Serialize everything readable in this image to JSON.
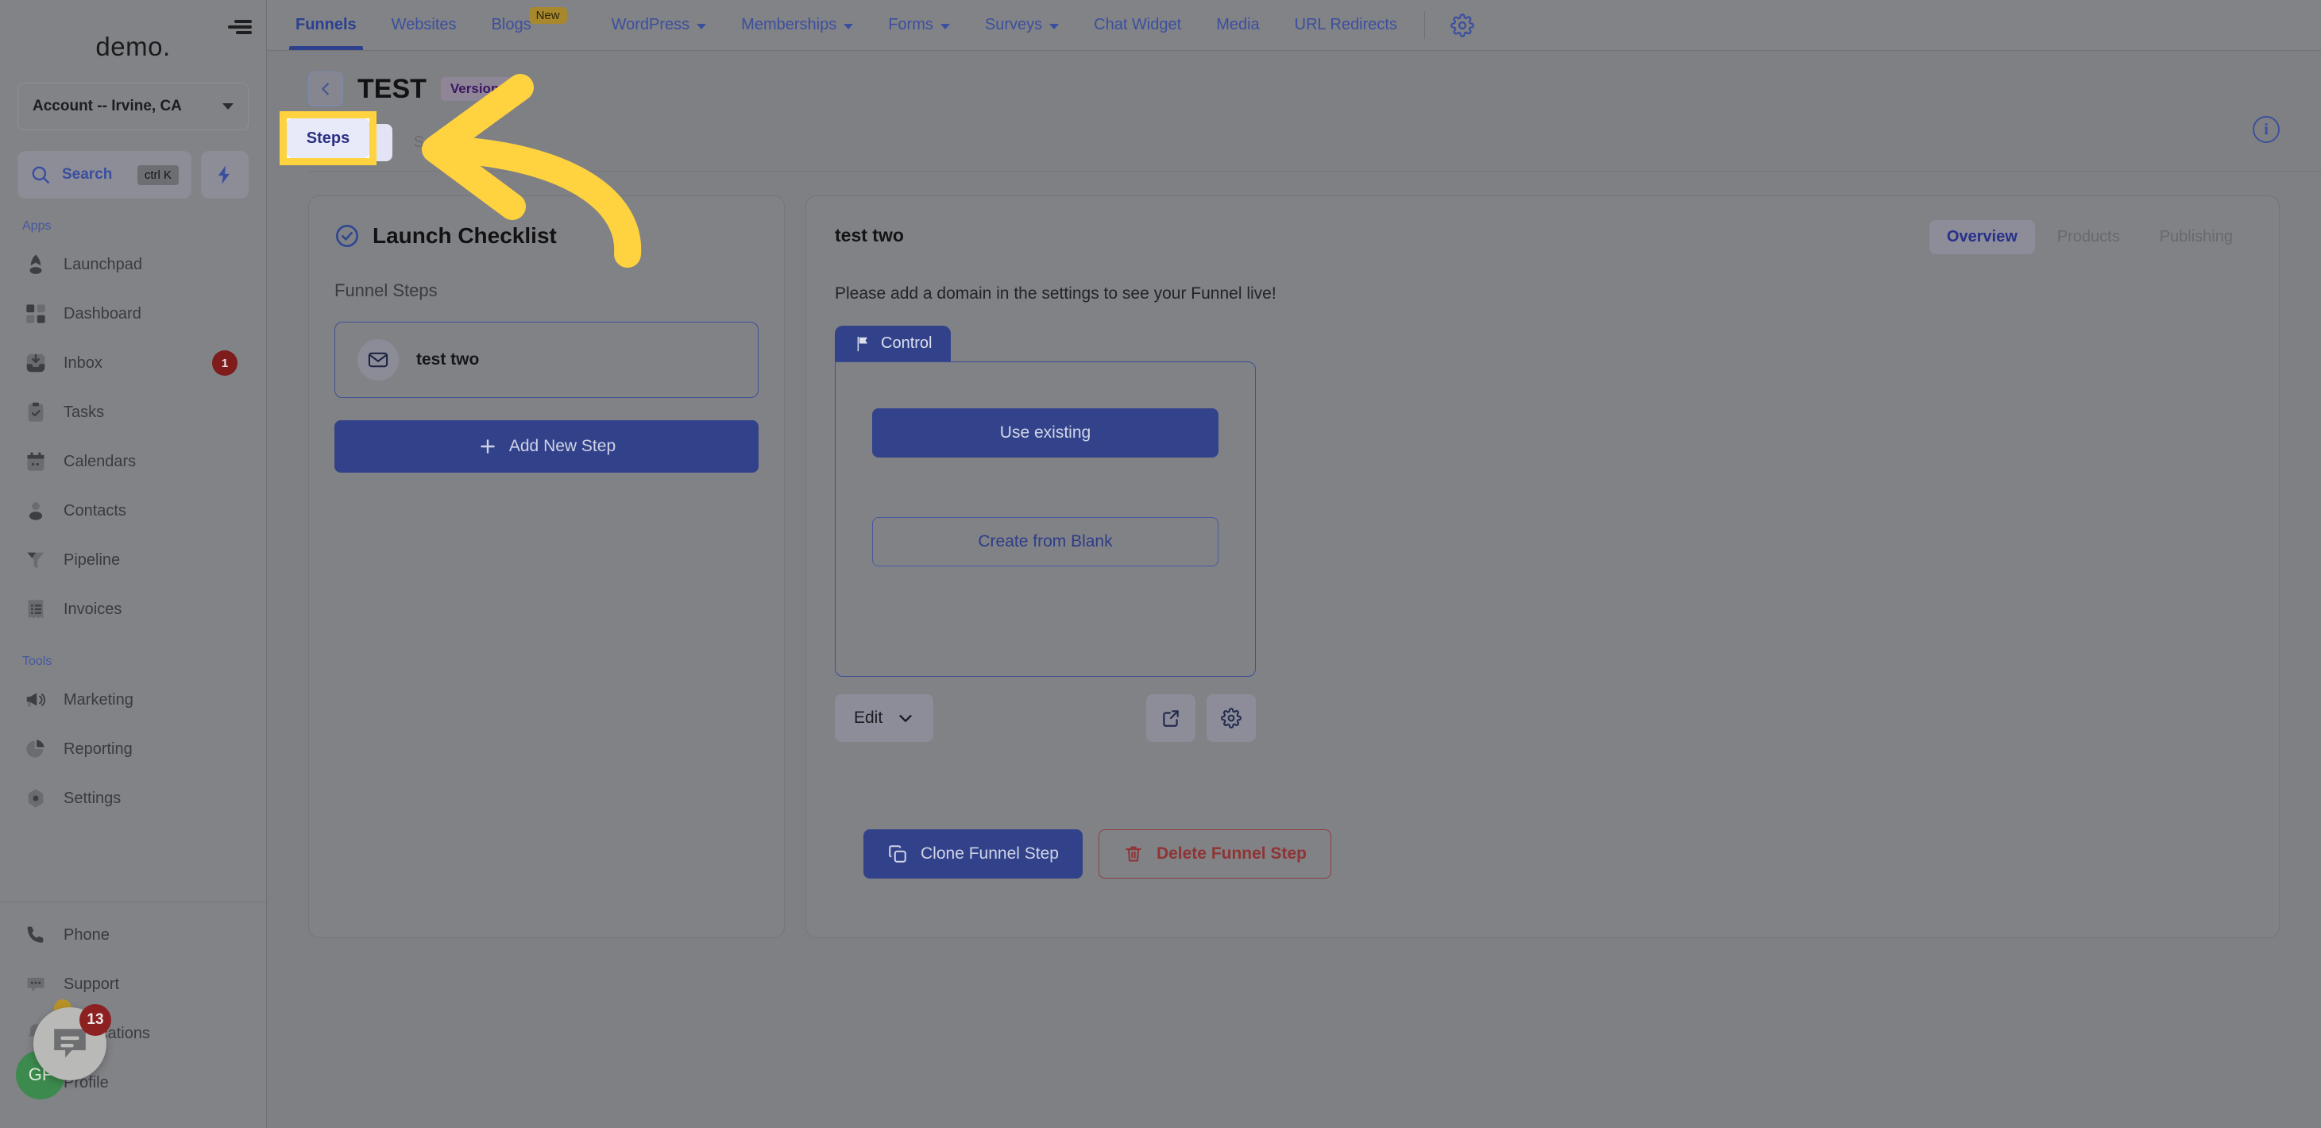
{
  "sidebar": {
    "brand": "demo.",
    "account_selector": "Account -- Irvine, CA",
    "search": {
      "label": "Search",
      "shortcut": "ctrl K"
    },
    "section_apps": "Apps",
    "section_tools": "Tools",
    "apps": [
      {
        "label": "Launchpad",
        "icon": "rocket-icon",
        "badge": ""
      },
      {
        "label": "Dashboard",
        "icon": "grid-icon",
        "badge": ""
      },
      {
        "label": "Inbox",
        "icon": "inbox-icon",
        "badge": "1"
      },
      {
        "label": "Tasks",
        "icon": "clipboard-check-icon",
        "badge": ""
      },
      {
        "label": "Calendars",
        "icon": "calendar-icon",
        "badge": ""
      },
      {
        "label": "Contacts",
        "icon": "person-icon",
        "badge": ""
      },
      {
        "label": "Pipeline",
        "icon": "funnel-icon",
        "badge": ""
      },
      {
        "label": "Invoices",
        "icon": "invoice-icon",
        "badge": ""
      }
    ],
    "tools": [
      {
        "label": "Marketing",
        "icon": "megaphone-icon",
        "badge": ""
      },
      {
        "label": "Reporting",
        "icon": "pie-chart-icon",
        "badge": ""
      },
      {
        "label": "Settings",
        "icon": "gear-hex-icon",
        "badge": ""
      }
    ],
    "bottom": [
      {
        "label": "Phone",
        "icon": "phone-icon",
        "badge": ""
      },
      {
        "label": "Support",
        "icon": "chat-dots-icon",
        "badge": ""
      },
      {
        "label": "Notifications",
        "icon": "bell-icon",
        "badge": ""
      },
      {
        "label": "Profile",
        "icon": "avatar-icon",
        "badge": ""
      }
    ],
    "chat_widget": {
      "badge": "13",
      "avatar_initials": "GF"
    }
  },
  "topnav": {
    "items": [
      {
        "label": "Funnels",
        "active": true,
        "caret": false,
        "pill": ""
      },
      {
        "label": "Websites",
        "active": false,
        "caret": false,
        "pill": ""
      },
      {
        "label": "Blogs",
        "active": false,
        "caret": false,
        "pill": "New"
      },
      {
        "label": "WordPress",
        "active": false,
        "caret": true,
        "pill": ""
      },
      {
        "label": "Memberships",
        "active": false,
        "caret": true,
        "pill": ""
      },
      {
        "label": "Forms",
        "active": false,
        "caret": true,
        "pill": ""
      },
      {
        "label": "Surveys",
        "active": false,
        "caret": true,
        "pill": ""
      },
      {
        "label": "Chat Widget",
        "active": false,
        "caret": false,
        "pill": ""
      },
      {
        "label": "Media",
        "active": false,
        "caret": false,
        "pill": ""
      },
      {
        "label": "URL Redirects",
        "active": false,
        "caret": false,
        "pill": ""
      }
    ],
    "settings_icon": "gear-icon"
  },
  "page": {
    "title": "TEST",
    "version_badge": "Version 2",
    "back_icon": "chevron-left-icon",
    "info_icon": "info-icon",
    "tabs": [
      {
        "label": "Steps",
        "active": true
      },
      {
        "label": "Settings",
        "active": false
      }
    ]
  },
  "left_panel": {
    "checklist_title": "Launch Checklist",
    "checklist_icon": "check-circle-icon",
    "funnel_steps_label": "Funnel Steps",
    "steps": [
      {
        "name": "test two",
        "icon": "mail-icon"
      }
    ],
    "add_step_label": "Add New Step",
    "add_step_icon": "plus-icon"
  },
  "right_panel": {
    "step_title": "test two",
    "segments": [
      {
        "label": "Overview",
        "active": true
      },
      {
        "label": "Products",
        "active": false
      },
      {
        "label": "Publishing",
        "active": false
      }
    ],
    "domain_note": "Please add a domain in the settings to see your Funnel live!",
    "control_tab": {
      "label": "Control",
      "icon": "flag-icon"
    },
    "use_existing_label": "Use existing",
    "create_blank_label": "Create from Blank",
    "edit_label": "Edit",
    "edit_caret_icon": "chevron-down-icon",
    "preview_icon": "external-link-icon",
    "settings_icon": "gear-icon",
    "clone_label": "Clone Funnel Step",
    "clone_icon": "copy-icon",
    "delete_label": "Delete Funnel Step",
    "delete_icon": "trash-icon"
  },
  "annotation": {
    "highlight_target": "Steps",
    "arrow_color": "#FFD23F",
    "highlight_color": "#FFD23F"
  }
}
